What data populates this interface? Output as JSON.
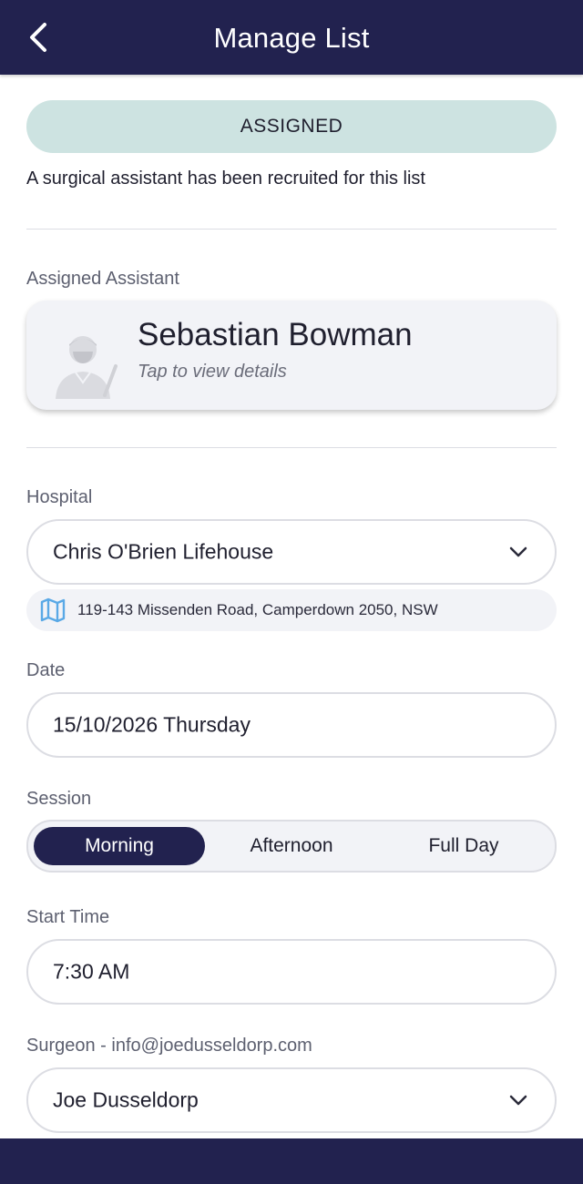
{
  "header": {
    "title": "Manage List",
    "back_icon": "chevron-left-icon"
  },
  "status": {
    "badge": "ASSIGNED",
    "message": "A surgical assistant has been recruited for this list"
  },
  "assistant": {
    "label": "Assigned Assistant",
    "name": "Sebastian Bowman",
    "hint": "Tap to view details",
    "avatar_icon": "surgeon-avatar-icon"
  },
  "hospital": {
    "label": "Hospital",
    "value": "Chris O'Brien Lifehouse",
    "address": "119-143 Missenden Road, Camperdown 2050, NSW",
    "address_icon": "map-icon"
  },
  "date": {
    "label": "Date",
    "value": "15/10/2026 Thursday"
  },
  "session": {
    "label": "Session",
    "options": [
      "Morning",
      "Afternoon",
      "Full Day"
    ],
    "selected": "Morning"
  },
  "start_time": {
    "label": "Start Time",
    "value": "7:30 AM"
  },
  "surgeon": {
    "label": "Surgeon - info@joedusseldorp.com",
    "value": "Joe Dusseldorp"
  },
  "colors": {
    "brand_navy": "#22224f",
    "status_pill": "#cde3e1",
    "card_bg": "#f2f3f7",
    "border": "#dcdde3",
    "map_icon": "#5aa9e6"
  }
}
